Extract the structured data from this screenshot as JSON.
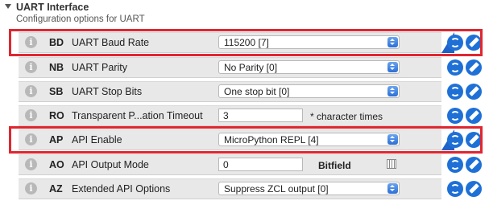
{
  "section": {
    "title": "UART Interface",
    "description": "Configuration options for UART"
  },
  "settings": [
    {
      "code": "BD",
      "label": "UART Baud Rate",
      "type": "select",
      "value": "115200 [7]",
      "highlighted": true
    },
    {
      "code": "NB",
      "label": "UART Parity",
      "type": "select",
      "value": "No Parity [0]"
    },
    {
      "code": "SB",
      "label": "UART Stop Bits",
      "type": "select",
      "value": "One stop bit [0]"
    },
    {
      "code": "RO",
      "label": "Transparent P...ation Timeout",
      "type": "text",
      "value": "3",
      "suffix": "* character times"
    },
    {
      "code": "AP",
      "label": "API Enable",
      "type": "select",
      "value": "MicroPython REPL [4]",
      "highlighted": true
    },
    {
      "code": "AO",
      "label": "API Output Mode",
      "type": "text",
      "value": "0",
      "suffix": "Bitfield"
    },
    {
      "code": "AZ",
      "label": "Extended API Options",
      "type": "select",
      "value": "Suppress ZCL output [0]"
    }
  ],
  "icons": {
    "info": "info-icon",
    "read": "refresh-icon",
    "write": "pencil-icon",
    "bitfield": "grid-icon"
  },
  "colors": {
    "accent": "#1e70d6",
    "highlight": "#e0262f",
    "row_bg": "#e8e8e8"
  }
}
